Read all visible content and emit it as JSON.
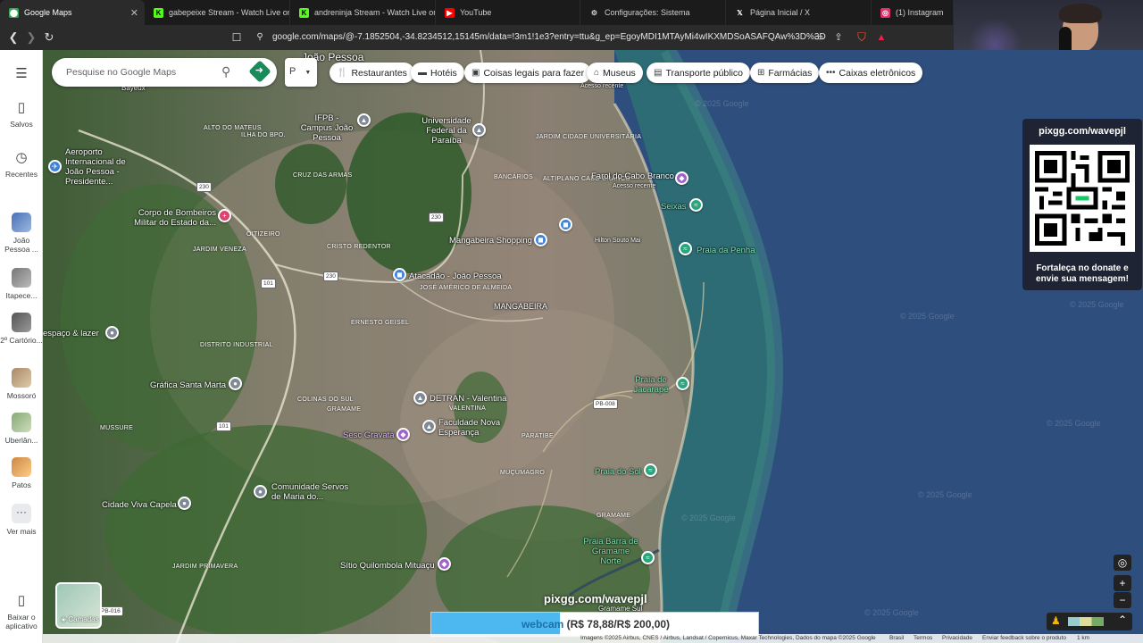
{
  "browser": {
    "tabs": [
      {
        "label": "Google Maps",
        "icon": "google-maps-icon",
        "color": "#34a853"
      },
      {
        "label": "gabepeixe Stream - Watch Live on K",
        "icon": "kick-icon",
        "color": "#53fc18"
      },
      {
        "label": "andreninja Stream - Watch Live on K",
        "icon": "kick-icon",
        "color": "#53fc18"
      },
      {
        "label": "YouTube",
        "icon": "youtube-icon",
        "color": "#ff0000"
      },
      {
        "label": "Configurações: Sistema",
        "icon": "gear-icon",
        "color": "#cccccc"
      },
      {
        "label": "Página Inicial / X",
        "icon": "x-icon",
        "color": "#ffffff"
      },
      {
        "label": "(1) Instagram",
        "icon": "instagram-icon",
        "color": "#e1306c"
      }
    ],
    "url": "google.com/maps/@-7.1852504,-34.8234512,15145m/data=!3m1!1e3?entry=ttu&g_ep=EgoyMDI1MTAyMi4wIKXMDSoASAFQAw%3D%3D"
  },
  "sidebar": {
    "menu_icon": "menu-icon",
    "items": [
      {
        "label": "Salvos",
        "icon": "bookmark-icon"
      },
      {
        "label": "Recentes",
        "icon": "history-icon"
      },
      {
        "label": "João Pessoa ...",
        "icon": "thumbnail"
      },
      {
        "label": "Itapece...",
        "icon": "thumbnail"
      },
      {
        "label": "2º Cartório...",
        "icon": "thumbnail"
      },
      {
        "label": "Mossoró",
        "icon": "thumbnail"
      },
      {
        "label": "Uberlân...",
        "icon": "thumbnail"
      },
      {
        "label": "Patos",
        "icon": "thumbnail"
      },
      {
        "label": "Ver mais",
        "icon": "more-icon"
      },
      {
        "label": "Baixar o aplicativo",
        "icon": "phone-icon"
      }
    ]
  },
  "search": {
    "placeholder": "Pesquise no Google Maps",
    "mini_label": "P"
  },
  "chips": [
    {
      "label": "Restaurantes",
      "icon": "restaurant-icon"
    },
    {
      "label": "Hotéis",
      "icon": "hotel-icon"
    },
    {
      "label": "Coisas legais para fazer",
      "icon": "camera-icon"
    },
    {
      "label": "Museus",
      "icon": "museum-icon"
    },
    {
      "label": "Transporte público",
      "icon": "bus-icon"
    },
    {
      "label": "Farmácias",
      "icon": "pharmacy-icon"
    },
    {
      "label": "Caixas eletrônicos",
      "icon": "atm-icon"
    }
  ],
  "map": {
    "places": {
      "city": "João Pessoa",
      "airport": "Aeroporto Internacional de João Pessoa - Presidente...",
      "bombeiros": "Corpo de Bombeiros Militar do Estado da...",
      "ifpb": "IFPB - Campus João Pessoa",
      "ufpb": "Universidade Federal da Paraíba",
      "farol": "Farol do Cabo Branco",
      "farol_sub": "Acesso recente",
      "seixas": "Seixas",
      "penha": "Praia da Penha",
      "mangabeira_shop": "Mangabeira Shopping",
      "hilton": "Hilton Souto Mai",
      "atacadao": "Atacadão - João Pessoa",
      "mangabeira": "MANGABEIRA",
      "espaco": "espaço & lazer",
      "grafica": "Gráfica Santa Marta",
      "detran": "DETRAN - Valentina",
      "faculdade": "Faculdade Nova Esperança",
      "sesc": "Sesc Gravatá",
      "jacarape": "Praia de Jacarapé",
      "sol": "Praia do Sol",
      "comunidade": "Comunidade Servos de Maria do...",
      "capela": "Cidade Viva Capela",
      "barra": "Praia Barra de Gramame Norte",
      "mituacu": "Sítio Quilombola Mituaçu",
      "gramame_sul": "Gramame Sul",
      "bayeux": "Bayeux",
      "acesso": "Acesso recente"
    },
    "hoods": [
      "ALTO DO MATEUS",
      "ILHA DO BPO.",
      "CRUZ DAS ARMAS",
      "OITIZEIRO",
      "JARDIM VENEZA",
      "DISTRITO INDUSTRIAL",
      "CRISTO REDENTOR",
      "JARDIM CIDADE UNIVERSITÁRIA",
      "ALTIPLANO CABO BRANCO",
      "BANCÁRIOS",
      "JOSÉ AMÉRICO DE ALMEIDA",
      "ERNESTO GEISEL",
      "COLINAS DO SUL",
      "GRAMAME",
      "VALENTINA",
      "PARATIBE",
      "MUÇUMAGRO",
      "MUSSURE",
      "GRAMAME",
      "JARDIM PRIMAVERA"
    ],
    "roads": [
      "230",
      "230",
      "101",
      "230",
      "101",
      "PB-008",
      "PB-016"
    ],
    "watermark": "© 2025 Google"
  },
  "donate": {
    "url": "pixgg.com/wavepjl",
    "message": "Fortaleça no donate e envie sua mensagem!"
  },
  "stream": {
    "pix_url": "pixgg.com/wavepjl",
    "goal_label": "webcam",
    "goal_text": "(R$ 78,88/R$ 200,00)",
    "goal_progress": 0.394
  },
  "layers_label": "Camadas",
  "footer": {
    "imagery": "Imagens ©2025 Airbus, CNES / Airbus, Landsat / Copernicus, Maxar Technologies, Dados do mapa ©2025 Google",
    "country": "Brasil",
    "terms": "Termos",
    "privacy": "Privacidade",
    "feedback": "Enviar feedback sobre o produto",
    "scale": "1 km"
  }
}
